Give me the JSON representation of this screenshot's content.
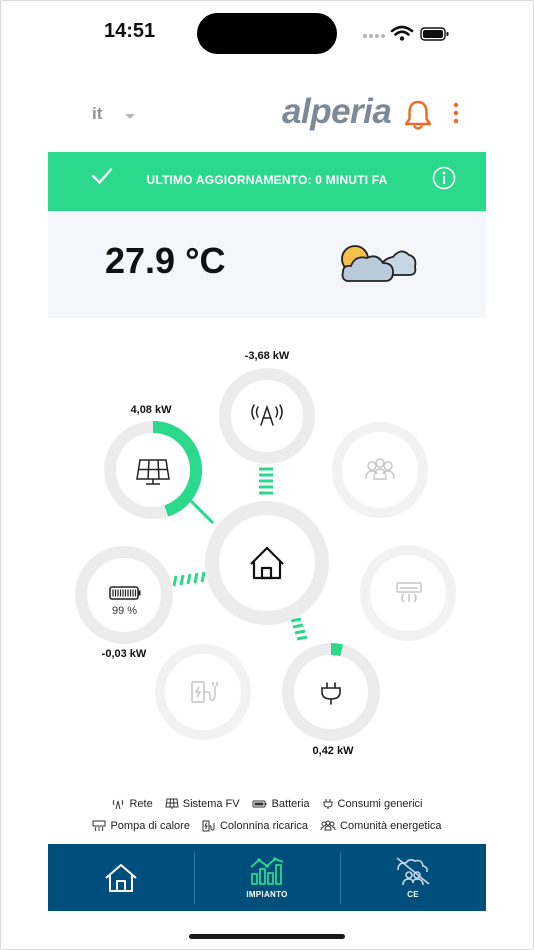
{
  "status_bar": {
    "time": "14:51"
  },
  "header": {
    "language": "it",
    "logo": "alperia",
    "bell_icon": "bell-icon",
    "menu_icon": "kebab-icon"
  },
  "banner": {
    "text": "ULTIMO AGGIORNAMENTO: 0 MINUTI FA",
    "color": "#2bd98c"
  },
  "weather": {
    "temperature": "27.9 °C",
    "icon": "partly-cloudy-icon"
  },
  "energy": {
    "grid": {
      "value": "-3,68 kW"
    },
    "solar": {
      "value": "4,08 kW",
      "fill": 0.45
    },
    "battery": {
      "value": "-0,03 kW",
      "percent": "99 %"
    },
    "consumption": {
      "value": "0,42 kW",
      "fill": 0.04
    },
    "accent": "#2bd98c"
  },
  "legend": {
    "rete": "Rete",
    "sistema_fv": "Sistema FV",
    "batteria": "Batteria",
    "consumi": "Consumi generici",
    "pompa": "Pompa di calore",
    "colonnina": "Colonnina ricarica",
    "comunita": "Comunità energetica"
  },
  "nav": {
    "impianto": "IMPIANTO",
    "ce": "CE",
    "background": "#004e7c"
  }
}
